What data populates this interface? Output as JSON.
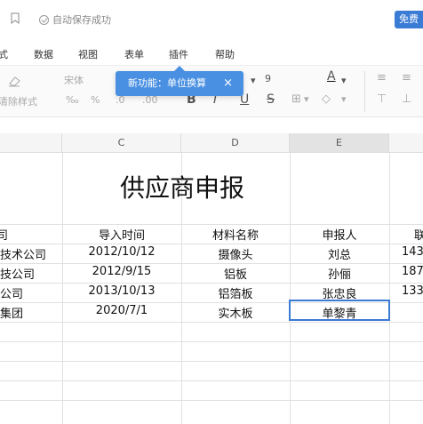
{
  "titlebar": {
    "save_status": "自动保存成功",
    "user_button": "免费"
  },
  "menubar": {
    "items": [
      "式",
      "数据",
      "视图",
      "表单",
      "插件",
      "帮助"
    ]
  },
  "toolbar": {
    "clear_format": "清除样式",
    "font_name": "宋体",
    "font_size": "9",
    "percent": "%",
    "thousand": "‰"
  },
  "tooltip": {
    "text": "新功能：单位换算",
    "close": "×"
  },
  "columns": [
    "C",
    "D",
    "E"
  ],
  "sheet": {
    "title": "供应商申报",
    "headers": {
      "b": "司",
      "c": "导入时间",
      "d": "材料名称",
      "e": "申报人",
      "f": "联"
    },
    "rows": [
      {
        "b": "技术公司",
        "c": "2012/10/12",
        "d": "摄像头",
        "e": "刘总",
        "f": "143"
      },
      {
        "b": "技公司",
        "c": "2012/9/15",
        "d": "铝板",
        "e": "孙俪",
        "f": "187"
      },
      {
        "b": "公司",
        "c": "2013/10/13",
        "d": "铝箔板",
        "e": "张忠良",
        "f": "133"
      },
      {
        "b": "集团",
        "c": "2020/7/1",
        "d": "实木板",
        "e": "单黎青",
        "f": ""
      }
    ]
  }
}
